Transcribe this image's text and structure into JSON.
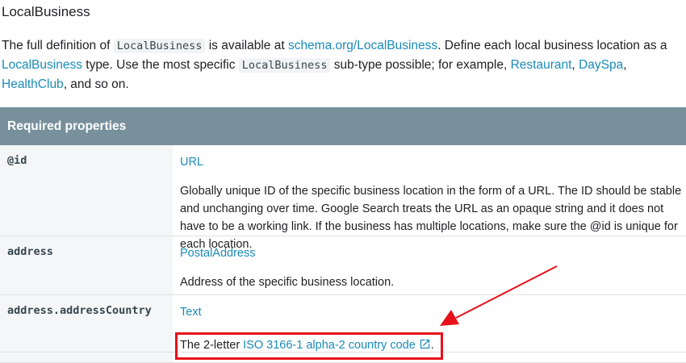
{
  "title": "LocalBusiness",
  "intro": {
    "p1": "The full definition of ",
    "code1": "LocalBusiness",
    "p2": " is available at ",
    "link_schema": "schema.org/LocalBusiness",
    "p3": ". Define each local business location as a ",
    "link_lb": "LocalBusiness",
    "p4": " type. Use the most specific ",
    "code2": "LocalBusiness",
    "p5": " sub-type possible; for example, ",
    "link_restaurant": "Restaurant",
    "sep1": ", ",
    "link_dayspa": "DaySpa",
    "sep2": ", ",
    "link_healthclub": "HealthClub",
    "p6": ", and so on."
  },
  "table": {
    "header": "Required properties",
    "rows": [
      {
        "property": "@id",
        "type": "URL",
        "description": "Globally unique ID of the specific business location in the form of a URL. The ID should be stable and unchanging over time. Google Search treats the URL as an opaque string and it does not have to be a working link. If the business has multiple locations, make sure the @id is unique for each location."
      },
      {
        "property": "address",
        "type": "PostalAddress",
        "description": "Address of the specific business location."
      },
      {
        "property": "address.addressCountry",
        "type": "Text",
        "desc_prefix": "The 2-letter ",
        "desc_link": "ISO 3166-1 alpha-2 country code",
        "desc_suffix": "."
      }
    ]
  },
  "colors": {
    "header_bg": "#78909c",
    "link": "#1a8bb8",
    "annotation": "#e8101a"
  },
  "icons": [
    "external-link-icon",
    "red-arrow-annotation"
  ]
}
